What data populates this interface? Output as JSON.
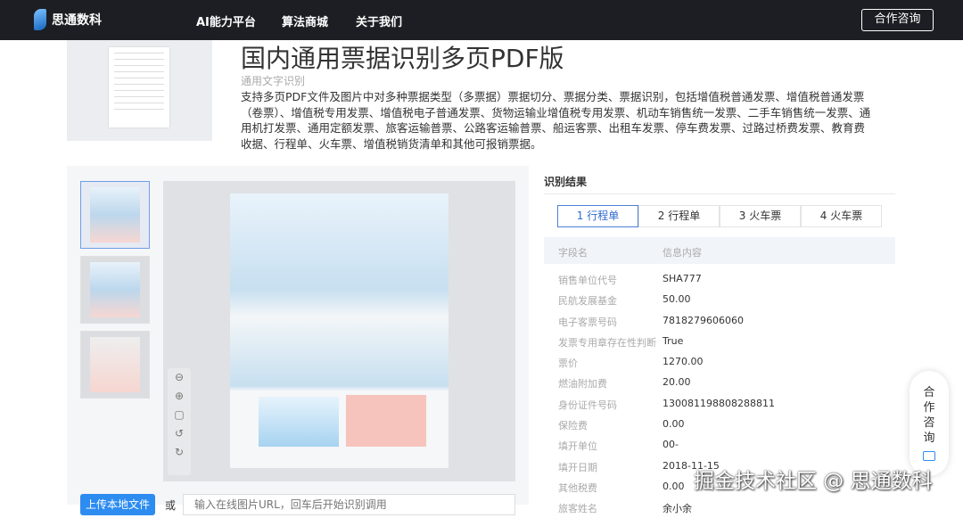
{
  "nav": {
    "brand": "思通数科",
    "items": [
      "AI能力平台",
      "算法商城",
      "关于我们"
    ],
    "consult": "合作咨询"
  },
  "hero": {
    "title": "国内通用票据识别多页PDF版",
    "subtitle": "通用文字识别",
    "description": "支持多页PDF文件及图片中对多种票据类型（多票据）票据切分、票据分类、票据识别，包括增值税普通发票、增值税普通发票（卷票）、增值税专用发票、增值税电子普通发票、货物运输业增值税专用发票、机动车销售统一发票、二手车销售统一发票、通用机打发票、通用定额发票、旅客运输普票、公路客运输普票、船运客票、出租车发票、停车费发票、过路过桥费发票、教育费收据、行程单、火车票、增值税销货清单和其他可报销票据。"
  },
  "viewer": {
    "tools": [
      "zoom-out",
      "zoom-in",
      "fit",
      "rotate-left",
      "rotate-right"
    ],
    "tool_glyphs": [
      "⊖",
      "⊕",
      "▢",
      "↺",
      "↻"
    ]
  },
  "upload": {
    "button": "上传本地文件",
    "or": "或",
    "placeholder": "输入在线图片URL，回车后开始识别调用"
  },
  "result": {
    "title": "识别结果",
    "tabs": [
      "1 行程单",
      "2 行程单",
      "3 火车票",
      "4 火车票"
    ],
    "header": [
      "字段名",
      "信息内容"
    ],
    "rows": [
      [
        "销售单位代号",
        "SHA777"
      ],
      [
        "民航发展基金",
        "50.00"
      ],
      [
        "电子客票号码",
        "7818279606060"
      ],
      [
        "发票专用章存在性判断",
        "True"
      ],
      [
        "票价",
        "1270.00"
      ],
      [
        "燃油附加费",
        "20.00"
      ],
      [
        "身份证件号码",
        "130081198808288811"
      ],
      [
        "保险费",
        "0.00"
      ],
      [
        "填开单位",
        "00-"
      ],
      [
        "填开日期",
        "2018-11-15"
      ],
      [
        "其他税费",
        "0.00"
      ],
      [
        "旅客姓名",
        "余小余"
      ]
    ]
  },
  "float": {
    "chars": [
      "合",
      "作",
      "咨",
      "询"
    ]
  },
  "watermark": "掘金技术社区 @ 思通数科"
}
